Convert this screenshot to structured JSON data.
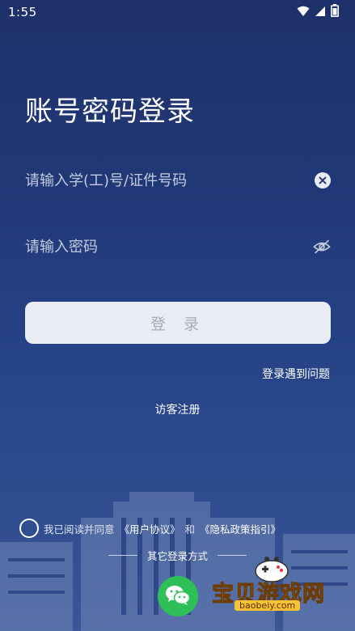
{
  "status_bar": {
    "time": "1:55",
    "icons": [
      "wifi-icon",
      "signal-icon",
      "battery-icon"
    ]
  },
  "login": {
    "title": "账号密码登录",
    "account_placeholder": "请输入学(工)号/证件号码",
    "password_placeholder": "请输入密码",
    "submit_label": "登 录",
    "trouble_link": "登录遇到问题",
    "guest_link": "访客注册"
  },
  "agreement": {
    "prefix": "我已阅读并同意",
    "user_agreement": "《用户协议》",
    "conjunction": "和",
    "privacy_policy": "《隐私政策指引》",
    "checked": false
  },
  "other_login": {
    "label": "其它登录方式",
    "options": [
      "wechat-icon"
    ]
  },
  "watermark": {
    "text": "宝贝游戏网",
    "url": "baobeiy.com"
  },
  "colors": {
    "background_top": "#1d3069",
    "background_bottom": "#3a5697",
    "button_bg": "#e9ecf3",
    "button_text": "#a5abbb",
    "wechat": "#2fbf57"
  }
}
